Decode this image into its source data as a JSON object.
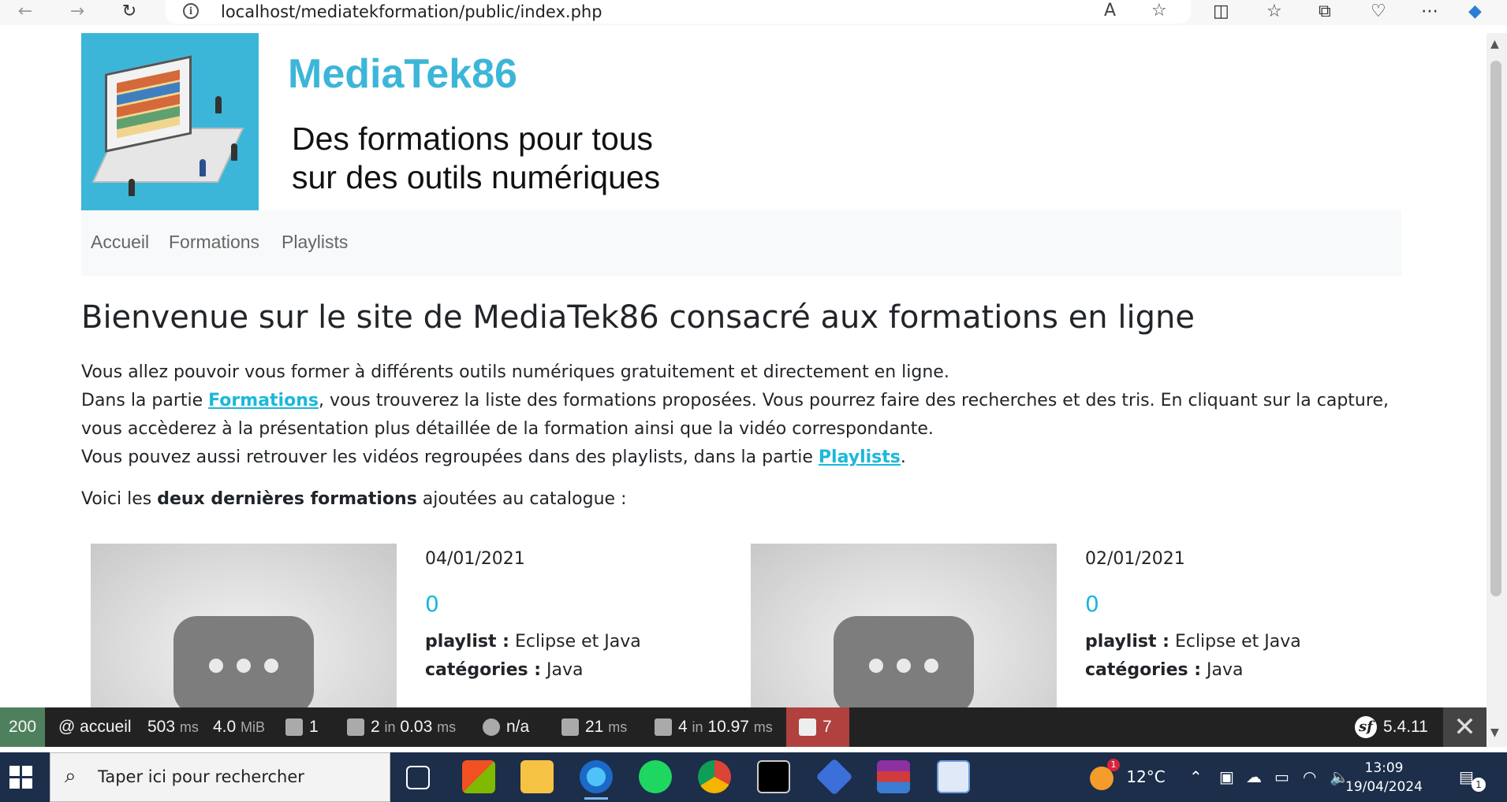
{
  "browser": {
    "url": "localhost/mediatekformation/public/index.php",
    "back_icon": "arrow-left-icon",
    "forward_icon": "arrow-right-icon",
    "reload_icon": "reload-icon"
  },
  "site": {
    "title": "MediaTek86",
    "tagline_line1": "Des formations pour tous",
    "tagline_line2": "sur des outils numériques"
  },
  "nav": {
    "items": [
      {
        "label": "Accueil"
      },
      {
        "label": "Formations"
      },
      {
        "label": "Playlists"
      }
    ]
  },
  "content": {
    "heading": "Bienvenue sur le site de MediaTek86 consacré aux formations en ligne",
    "p1": "Vous allez pouvoir vous former à différents outils numériques gratuitement et directement en ligne.",
    "p2_before": "Dans la partie ",
    "p2_link": "Formations",
    "p2_after": ", vous trouverez la liste des formations proposées. Vous pourrez faire des recherches et des tris. En cliquant sur la capture, vous accèderez à la présentation plus détaillée de la formation ainsi que la vidéo correspondante.",
    "p3_before": "Vous pouvez aussi retrouver les vidéos regroupées dans des playlists, dans la partie ",
    "p3_link": "Playlists",
    "p3_after": ".",
    "latest_before": "Voici les ",
    "latest_bold": "deux dernières formations",
    "latest_after": " ajoutées au catalogue :"
  },
  "formations": [
    {
      "date": "04/01/2021",
      "title": "0",
      "playlist_label": "playlist :",
      "playlist": " Eclipse et Java",
      "categories_label": "catégories :",
      "categories": " Java"
    },
    {
      "date": "02/01/2021",
      "title": "0",
      "playlist_label": "playlist :",
      "playlist": " Eclipse et Java",
      "categories_label": "catégories :",
      "categories": " Java"
    }
  ],
  "sf_toolbar": {
    "status": "200",
    "route": "@ accueil",
    "time": "503",
    "time_unit": "ms",
    "memory": "4.0",
    "memory_unit": "MiB",
    "logs": "1",
    "cache_count": "2",
    "cache_in": "in",
    "cache_time": "0.03",
    "cache_unit": "ms",
    "user": "n/a",
    "events_time": "21",
    "events_unit": "ms",
    "db_count": "4",
    "db_in": "in",
    "db_time": "10.97",
    "db_unit": "ms",
    "twig": "7",
    "version": "5.4.11"
  },
  "taskbar": {
    "search_placeholder": "Taper ici pour rechercher",
    "weather": "12°C",
    "time": "13:09",
    "date": "19/04/2024",
    "notification_count": "1",
    "weather_badge": "1"
  }
}
